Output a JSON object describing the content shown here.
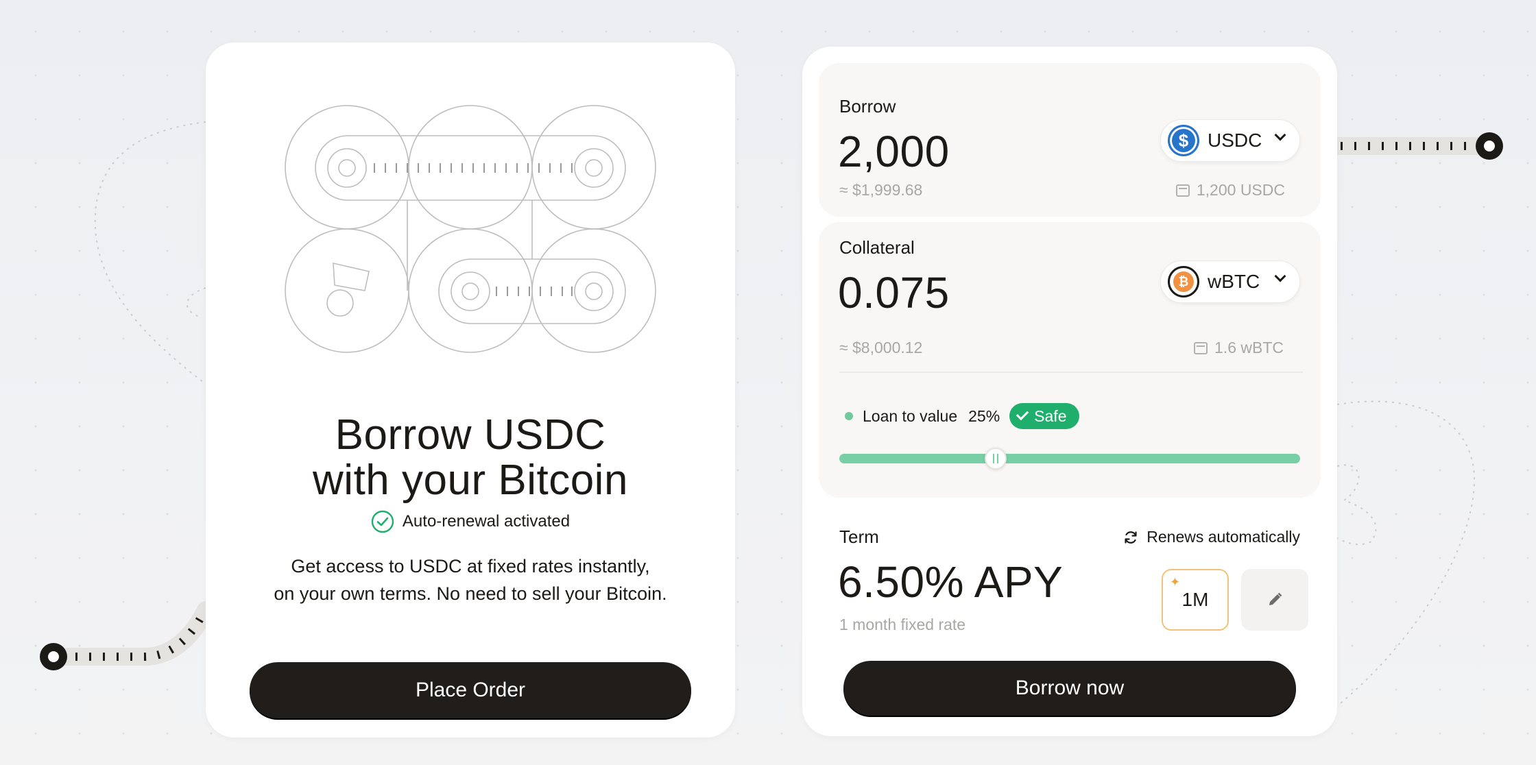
{
  "left_card": {
    "title_line1": "Borrow USDC",
    "title_line2": "with your Bitcoin",
    "auto_renewal": "Auto-renewal activated",
    "desc_line1": "Get access to USDC at fixed rates instantly,",
    "desc_line2": "on your own terms. No need to sell your Bitcoin.",
    "cta": "Place Order"
  },
  "borrow": {
    "label": "Borrow",
    "amount": "2,000",
    "usd_value": "≈ $1,999.68",
    "balance": "1,200 USDC",
    "token": "USDC",
    "token_icon": "usdc-icon"
  },
  "collateral": {
    "label": "Collateral",
    "amount": "0.075",
    "usd_value": "≈ $8,000.12",
    "balance": "1.6 wBTC",
    "token": "wBTC",
    "token_icon": "wbtc-icon",
    "ltv_label": "Loan to value",
    "ltv_value": "25%",
    "ltv_status": "Safe",
    "ltv_slider_fraction": 0.34
  },
  "term": {
    "label": "Term",
    "renews": "Renews automatically",
    "apy": "6.50% APY",
    "fixed_rate": "1 month fixed rate",
    "selected_option": "1M"
  },
  "cta": "Borrow now",
  "colors": {
    "accent_green": "#1fae6b",
    "slider_green": "#78cfa5",
    "button_dark": "#201d1a",
    "usdc_blue": "#2775ca",
    "btc_orange": "#f09242",
    "highlight_orange": "#f3c27a"
  }
}
